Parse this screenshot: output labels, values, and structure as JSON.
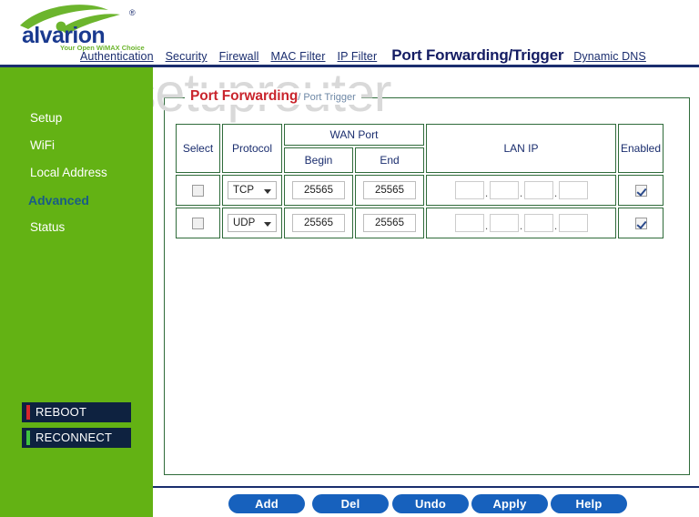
{
  "brand": {
    "name": "alvarion",
    "tagline": "Your Open WiMAX Choice",
    "trademark": "®",
    "logo_green": "#6cb52d",
    "logo_navy": "#1a2d6e"
  },
  "nav": {
    "items": [
      {
        "label": "Authentication",
        "active": false
      },
      {
        "label": "Security",
        "active": false
      },
      {
        "label": "Firewall",
        "active": false
      },
      {
        "label": "MAC Filter",
        "active": false
      },
      {
        "label": "IP Filter",
        "active": false
      },
      {
        "label": "Port Forwarding/Trigger",
        "active": true
      },
      {
        "label": "Dynamic DNS",
        "active": false
      }
    ]
  },
  "watermark": {
    "text": "setuprouter"
  },
  "sidebar": {
    "background": "#63b214",
    "items": [
      {
        "label": "Setup",
        "selected": false
      },
      {
        "label": "WiFi",
        "selected": false
      },
      {
        "label": "Local Address",
        "selected": false
      },
      {
        "label": "Advanced",
        "selected": true
      },
      {
        "label": "Status",
        "selected": false
      }
    ],
    "system_buttons": [
      {
        "label": "REBOOT",
        "accent": "#d6262c"
      },
      {
        "label": "RECONNECT",
        "accent": "#3fc23f"
      }
    ]
  },
  "panel": {
    "legend_main": "Port Forwarding",
    "legend_sub": "/ Port Trigger",
    "legend_main_color": "#c9252d",
    "legend_sub_color": "#6e88a6",
    "border_color": "#2f6b3a"
  },
  "table": {
    "headers": {
      "select": "Select",
      "protocol": "Protocol",
      "wan_port": "WAN Port",
      "begin": "Begin",
      "end": "End",
      "lan_ip": "LAN IP",
      "enabled": "Enabled"
    },
    "rows": [
      {
        "select_checked": false,
        "protocol": "TCP",
        "begin": "25565",
        "end": "25565",
        "lan_ip": [
          "",
          "",
          "",
          ""
        ],
        "enabled_checked": true
      },
      {
        "select_checked": false,
        "protocol": "UDP",
        "begin": "25565",
        "end": "25565",
        "lan_ip": [
          "",
          "",
          "",
          ""
        ],
        "enabled_checked": true
      }
    ],
    "ip_separator": "."
  },
  "footer": {
    "buttons": [
      {
        "label": "Add"
      },
      {
        "label": "Del"
      },
      {
        "label": "Undo"
      },
      {
        "label": "Apply"
      },
      {
        "label": "Help"
      }
    ],
    "button_color": "#1761bd"
  }
}
